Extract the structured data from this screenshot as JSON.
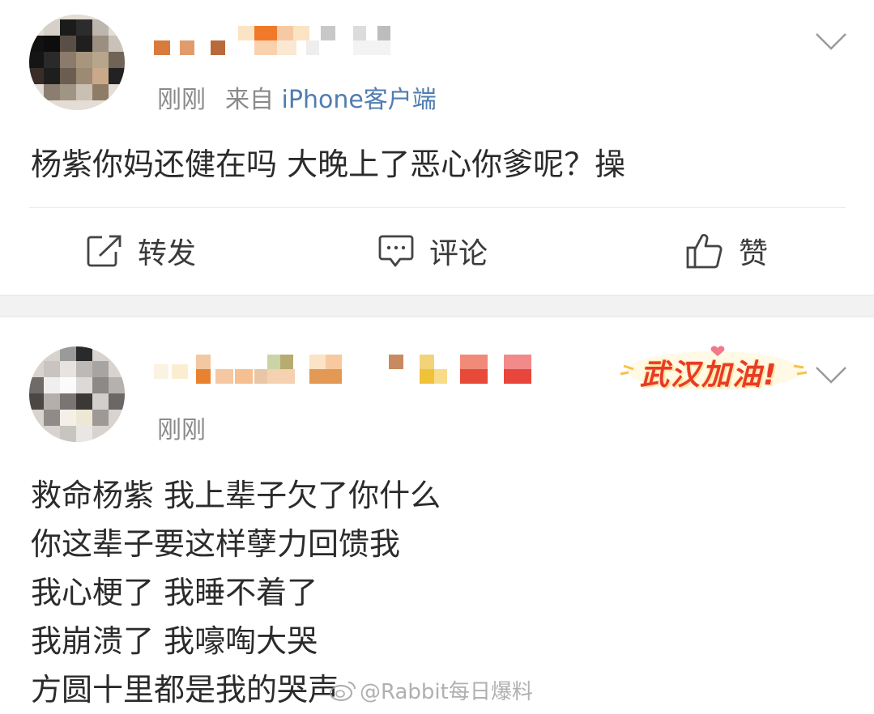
{
  "posts": [
    {
      "time": "刚刚",
      "source_prefix": "来自",
      "source_device": "iPhone客户端",
      "content": "杨紫你妈还健在吗 大晚上了恶心你爹呢？操",
      "actions": {
        "repost_label": "转发",
        "comment_label": "评论",
        "like_label": "赞"
      }
    },
    {
      "time": "刚刚",
      "badge_text": "武汉加油!",
      "content_lines": [
        "救命杨紫 我上辈子欠了你什么",
        "你这辈子要这样孽力回馈我",
        "我心梗了 我睡不着了",
        "我崩溃了 我嚎啕大哭",
        "方圆十里都是我的哭声"
      ]
    }
  ],
  "watermark": "@Rabbit每日爆料",
  "icons": {
    "repost": "repost-icon",
    "comment": "comment-icon",
    "like": "thumbs-up-icon",
    "more": "chevron-down-icon"
  },
  "colors": {
    "link_blue": "#507daf",
    "badge_red": "#e83a2b",
    "meta_gray": "#8a8a8a",
    "separator_gray": "#f2f2f2"
  }
}
